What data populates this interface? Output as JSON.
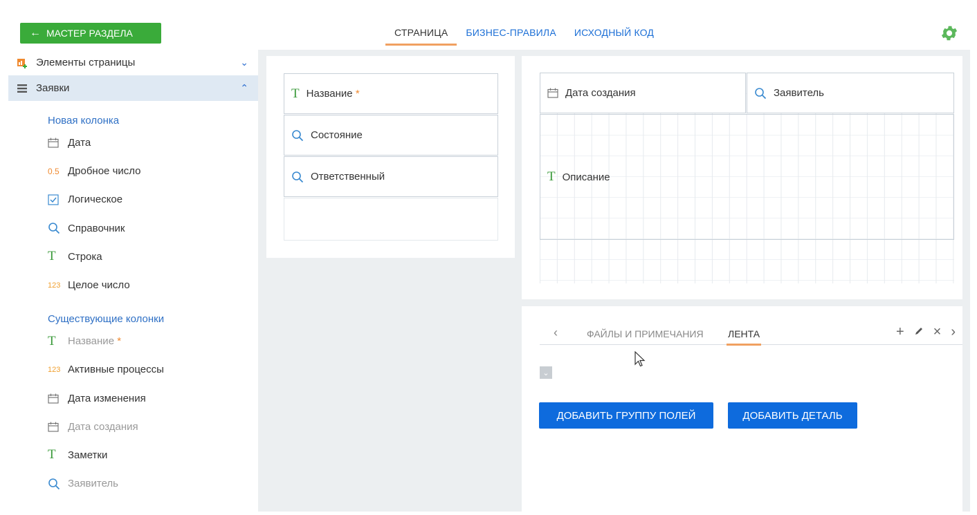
{
  "topbar": {
    "back_label": "МАСТЕР РАЗДЕЛА",
    "tabs": [
      {
        "label": "СТРАНИЦА",
        "active": true
      },
      {
        "label": "БИЗНЕС-ПРАВИЛА",
        "active": false
      },
      {
        "label": "ИСХОДНЫЙ КОД",
        "active": false
      }
    ],
    "settings_icon": "gear-icon"
  },
  "sidebar": {
    "page_elements_label": "Элементы страницы",
    "section_label": "Заявки",
    "new_group_title": "Новая колонка",
    "new_items": [
      {
        "label": "Дата",
        "icon": "calendar-icon"
      },
      {
        "label": "Дробное число",
        "icon": "decimal-icon",
        "icon_text": "0.5"
      },
      {
        "label": "Логическое",
        "icon": "checkbox-icon"
      },
      {
        "label": "Справочник",
        "icon": "search-icon"
      },
      {
        "label": "Строка",
        "icon": "text-icon",
        "icon_text": "T"
      },
      {
        "label": "Целое число",
        "icon": "integer-icon",
        "icon_text": "123"
      }
    ],
    "existing_group_title": "Существующие колонки",
    "existing_items": [
      {
        "label": "Название",
        "required": "*",
        "icon": "text-icon",
        "muted": true
      },
      {
        "label": "Активные процессы",
        "icon": "integer-icon"
      },
      {
        "label": "Дата изменения",
        "icon": "calendar-icon"
      },
      {
        "label": "Дата создания",
        "icon": "calendar-icon",
        "muted": true
      },
      {
        "label": "Заметки",
        "icon": "text-icon"
      },
      {
        "label": "Заявитель",
        "icon": "search-icon",
        "muted": true
      }
    ]
  },
  "panel_left": {
    "fields": [
      {
        "label": "Название",
        "required": "*",
        "icon": "text-icon"
      },
      {
        "label": "Состояние",
        "icon": "search-icon"
      },
      {
        "label": "Ответственный",
        "icon": "search-icon"
      }
    ]
  },
  "panel_right": {
    "fields": [
      {
        "label": "Дата создания",
        "icon": "calendar-icon"
      },
      {
        "label": "Заявитель",
        "icon": "search-icon"
      },
      {
        "label": "Описание",
        "icon": "text-icon"
      }
    ]
  },
  "detail_panel": {
    "tabs": [
      {
        "label": "ФАЙЛЫ И ПРИМЕЧАНИЯ",
        "active": false
      },
      {
        "label": "ЛЕНТА",
        "active": true
      }
    ],
    "add_group_label": "ДОБАВИТЬ ГРУППУ ПОЛЕЙ",
    "add_detail_label": "ДОБАВИТЬ ДЕТАЛЬ"
  },
  "colors": {
    "accent_green": "#3aab3a",
    "link_blue": "#1c6fd6",
    "button_blue": "#0e6bdd",
    "tab_underline": "#f0a060"
  }
}
